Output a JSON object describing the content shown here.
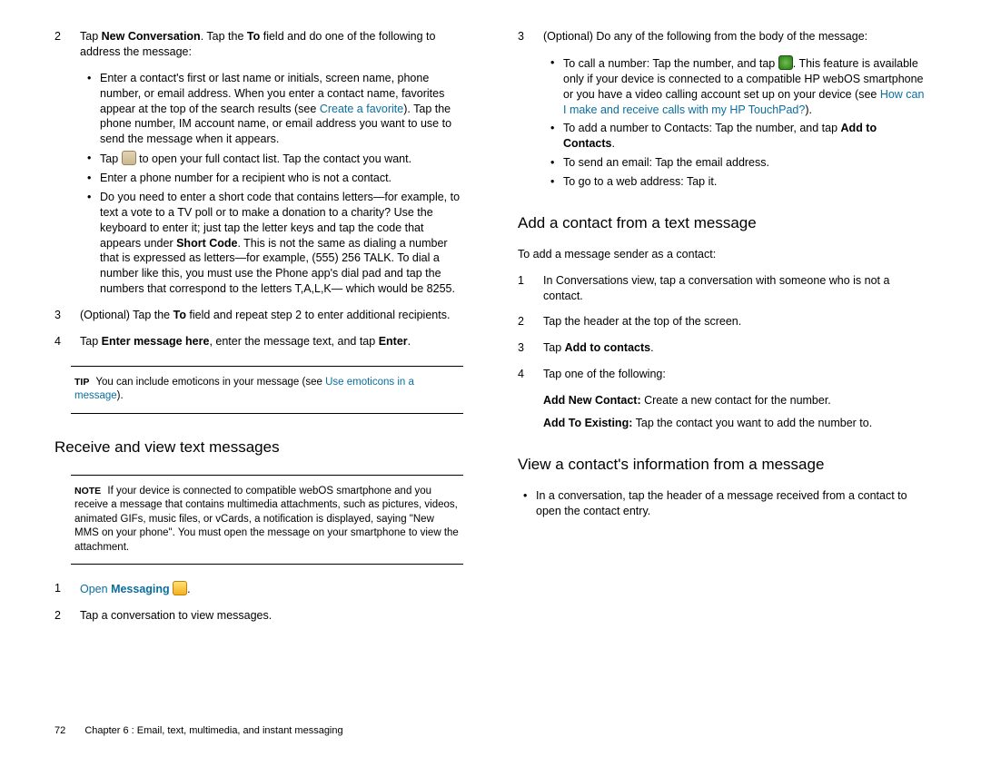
{
  "left": {
    "s2": {
      "num": "2",
      "t1": "Tap ",
      "b1": "New Conversation",
      "t2": ". Tap the ",
      "b2": "To",
      "t3": " field and do one of the following to address the message:"
    },
    "bul": {
      "a1": "Enter a contact's first or last name or initials, screen name, phone number, or email address. When you enter a contact name, favorites appear at the top of the search results (see ",
      "a_link": "Create a favorite",
      "a2": "). Tap the phone number, IM account name, or email address you want to use to send the message when it appears.",
      "b1": "Tap ",
      "b2": " to open your full contact list. Tap the contact you want.",
      "c": "Enter a phone number for a recipient who is not a contact.",
      "d1": "Do you need to enter a short code that contains letters—for example, to text a vote to a TV poll or to make a donation to a charity? Use the keyboard to enter it; just tap the letter keys and tap the code that appears under ",
      "d_bold": "Short Code",
      "d2": ". This is not the same as dialing a number that is expressed as letters—for example, (555) 256 TALK. To dial a number like this, you must use the Phone app's dial pad and tap the numbers that correspond to the letters T,A,L,K— which would be 8255."
    },
    "s3": {
      "num": "3",
      "t1": "(Optional) Tap the ",
      "b": "To",
      "t2": " field and repeat step 2 to enter additional recipients."
    },
    "s4": {
      "num": "4",
      "t1": "Tap ",
      "b1": "Enter message here",
      "t2": ", enter the message text, and tap ",
      "b2": "Enter",
      "t3": "."
    },
    "tip": {
      "lbl": "TIP",
      "t1": "You can include emoticons in your message (see ",
      "link": "Use emoticons in a message",
      "t2": ")."
    },
    "h_receive": "Receive and view text messages",
    "note": {
      "lbl": "NOTE",
      "t": "If your device is connected to compatible webOS smartphone and you receive a message that contains multimedia attachments, such as pictures, videos, animated GIFs, music files, or vCards, a notification is displayed, saying \"New MMS on your phone\". You must open the message on your smartphone to view the attachment."
    },
    "r1": {
      "num": "1",
      "link": "Open ",
      "bold": "Messaging",
      "tail": "."
    },
    "r2": {
      "num": "2",
      "t": "Tap a conversation to view messages."
    }
  },
  "right": {
    "s3": {
      "num": "3",
      "t": "(Optional) Do any of the following from the body of the message:"
    },
    "bul": {
      "a1": "To call a number: Tap the number, and tap ",
      "a2": ". This feature is available only if your device is connected to a compatible HP webOS smartphone or you have a video calling account set up on your device (see ",
      "a_link": "How can I make and receive calls with my HP TouchPad?",
      "a3": ").",
      "b1": "To add a number to Contacts: Tap the number, and tap ",
      "b_bold": "Add to Contacts",
      "b2": ".",
      "c": "To send an email: Tap the email address.",
      "d": "To go to a web address: Tap it."
    },
    "h_add": "Add a contact from a text message",
    "intro": "To add a message sender as a contact:",
    "a1": {
      "num": "1",
      "t": "In Conversations view, tap a conversation with someone who is not a contact."
    },
    "a2": {
      "num": "2",
      "t": "Tap the header at the top of the screen."
    },
    "a3": {
      "num": "3",
      "t1": "Tap ",
      "b": "Add to contacts",
      "t2": "."
    },
    "a4": {
      "num": "4",
      "t": "Tap one of the following:"
    },
    "sub1": {
      "b": "Add New Contact:",
      "t": " Create a new contact for the number."
    },
    "sub2": {
      "b": "Add To Existing:",
      "t": " Tap the contact you want to add the number to."
    },
    "h_view": "View a contact's information from a message",
    "vbul": "In a conversation, tap the header of a message received from a contact to open the contact entry."
  },
  "footer": {
    "page": "72",
    "chapter": "Chapter 6 : Email, text, multimedia, and instant messaging"
  }
}
